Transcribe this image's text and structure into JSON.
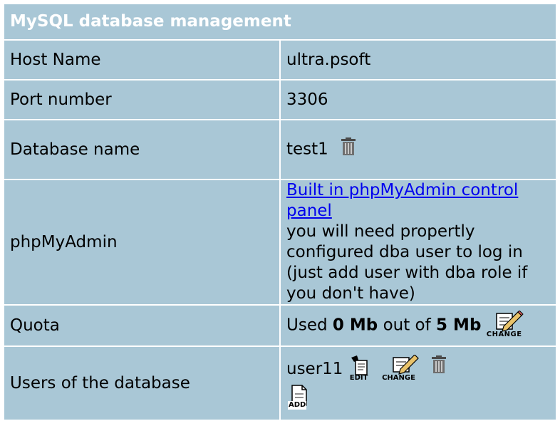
{
  "header": {
    "title": "MySQL database management"
  },
  "rows": {
    "host": {
      "label": "Host Name",
      "value": "ultra.psoft"
    },
    "port": {
      "label": "Port number",
      "value": "3306"
    },
    "database": {
      "label": "Database name",
      "value": "test1"
    },
    "phpmyadmin": {
      "label": "phpMyAdmin",
      "link_text": "Built in phpMyAdmin control panel",
      "note": "you will need propertly configured dba user to log in (just add user with dba role if you don't have)"
    },
    "quota": {
      "label": "Quota",
      "prefix": "Used",
      "used": "0 Mb",
      "middle": "out of",
      "total": "5 Mb",
      "change_icon_text": "CHANGE"
    },
    "users": {
      "label": "Users of the database",
      "items": [
        {
          "name": "user11"
        }
      ],
      "edit_icon_text": "EDIT",
      "change_icon_text": "CHANGE",
      "add_icon_text": "ADD"
    }
  },
  "colors": {
    "title_bg": "#1e4f78",
    "cell_bg": "#a9c7d6",
    "border": "#ffffff",
    "link": "#0000ee"
  },
  "icons": [
    "trash-icon",
    "change-icon",
    "edit-icon",
    "add-icon"
  ]
}
